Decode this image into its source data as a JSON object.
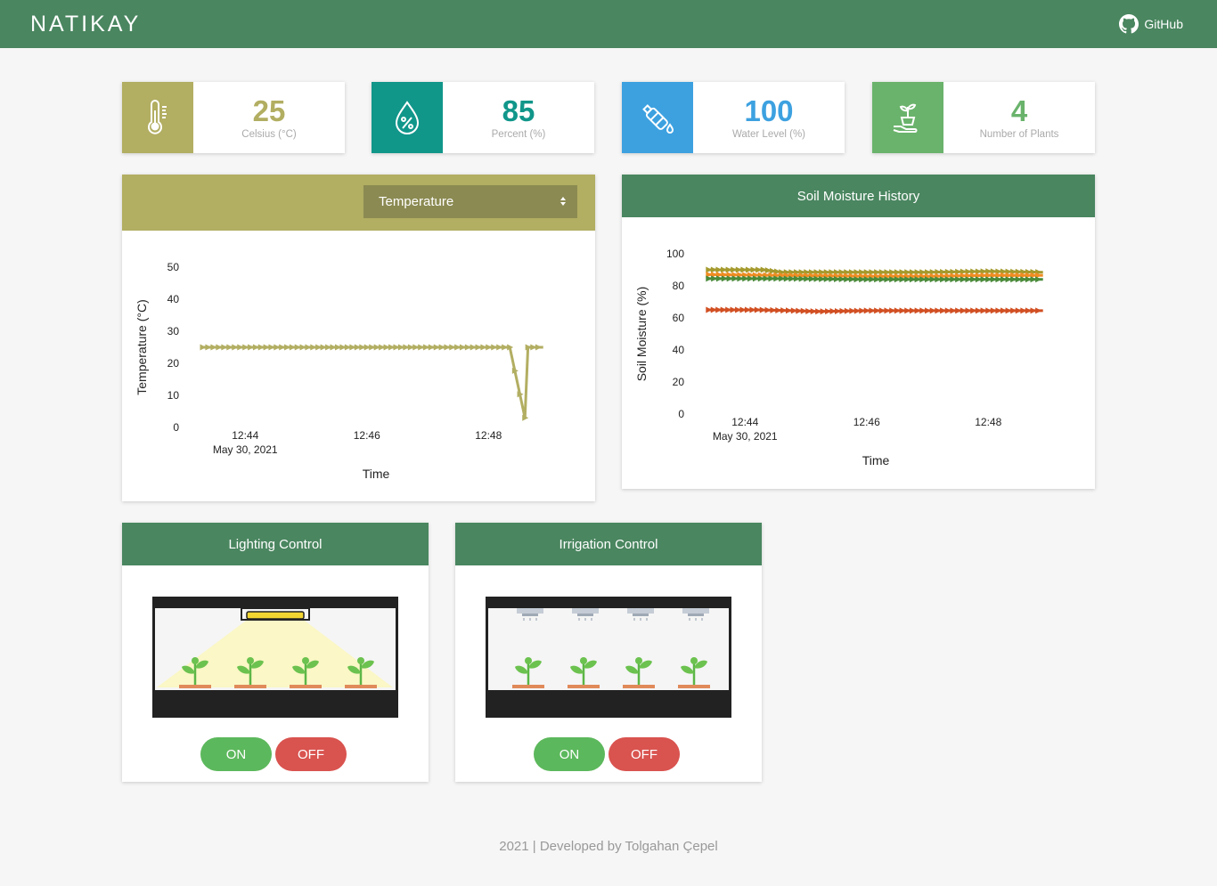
{
  "nav": {
    "brand": "NATIKAY",
    "github_label": "GitHub"
  },
  "cards": [
    {
      "value": "25",
      "label": "Celsius (°C)",
      "color": "#b2ae62",
      "icon": "thermometer-icon"
    },
    {
      "value": "85",
      "label": "Percent (%)",
      "color": "#11968a",
      "icon": "humidity-drop-icon"
    },
    {
      "value": "100",
      "label": "Water Level (%)",
      "color": "#3da1e0",
      "icon": "water-bottle-icon"
    },
    {
      "value": "4",
      "label": "Number of Plants",
      "color": "#6ab36c",
      "icon": "plant-hand-icon"
    }
  ],
  "temp_panel": {
    "select_value": "Temperature"
  },
  "moisture_panel": {
    "title": "Soil Moisture History"
  },
  "lighting": {
    "title": "Lighting Control",
    "on_label": "ON",
    "off_label": "OFF"
  },
  "irrigation": {
    "title": "Irrigation Control",
    "on_label": "ON",
    "off_label": "OFF"
  },
  "footer": {
    "text": "2021 | Developed by Tolgahan Çepel"
  },
  "chart_data": [
    {
      "type": "line",
      "ylabel": "Temperature (°C)",
      "xlabel": "Time",
      "ylim": [
        0,
        50
      ],
      "yticks": [
        0,
        10,
        20,
        30,
        40,
        50
      ],
      "xticks": [
        {
          "label": "12:44",
          "sublabel": "May 30, 2021",
          "t": 44.0
        },
        {
          "label": "12:46",
          "sublabel": "",
          "t": 46.0
        },
        {
          "label": "12:48",
          "sublabel": "",
          "t": 48.0
        }
      ],
      "series": [
        {
          "color": "#b2ae62",
          "points": [
            [
              43.3,
              25
            ],
            [
              44.0,
              25
            ],
            [
              44.6,
              25
            ],
            [
              45.2,
              25
            ],
            [
              46.0,
              25
            ],
            [
              46.8,
              25
            ],
            [
              47.4,
              25
            ],
            [
              48.0,
              25
            ],
            [
              48.35,
              25
            ],
            [
              48.6,
              3
            ],
            [
              48.65,
              25
            ],
            [
              48.9,
              25
            ]
          ]
        }
      ],
      "grid": false
    },
    {
      "type": "line",
      "ylabel": "Soil Moisture (%)",
      "xlabel": "Time",
      "ylim": [
        0,
        100
      ],
      "yticks": [
        0,
        20,
        40,
        60,
        80,
        100
      ],
      "xticks": [
        {
          "label": "12:44",
          "sublabel": "May 30, 2021",
          "t": 44.0
        },
        {
          "label": "12:46",
          "sublabel": "",
          "t": 46.0
        },
        {
          "label": "12:48",
          "sublabel": "",
          "t": 48.0
        }
      ],
      "series": [
        {
          "color": "#a49a2e",
          "points": [
            [
              43.4,
              90
            ],
            [
              44.3,
              90
            ],
            [
              44.6,
              88.5
            ],
            [
              46.0,
              88.5
            ],
            [
              47.0,
              88.5
            ],
            [
              48.0,
              89
            ],
            [
              48.9,
              88.5
            ]
          ]
        },
        {
          "color": "#f08c22",
          "points": [
            [
              43.4,
              87
            ],
            [
              44.6,
              86.5
            ],
            [
              46.0,
              86
            ],
            [
              47.0,
              86
            ],
            [
              48.0,
              86.5
            ],
            [
              48.9,
              86.5
            ]
          ]
        },
        {
          "color": "#4a8a3a",
          "points": [
            [
              43.4,
              84.5
            ],
            [
              44.6,
              84.5
            ],
            [
              46.0,
              84
            ],
            [
              47.0,
              84
            ],
            [
              48.0,
              84
            ],
            [
              48.9,
              84
            ]
          ]
        },
        {
          "color": "#d14f22",
          "points": [
            [
              43.4,
              65
            ],
            [
              44.2,
              65
            ],
            [
              44.8,
              64.5
            ],
            [
              45.2,
              64
            ],
            [
              46.0,
              64.5
            ],
            [
              47.0,
              64.5
            ],
            [
              48.0,
              64.5
            ],
            [
              48.9,
              64.5
            ]
          ]
        }
      ],
      "grid": false
    }
  ]
}
